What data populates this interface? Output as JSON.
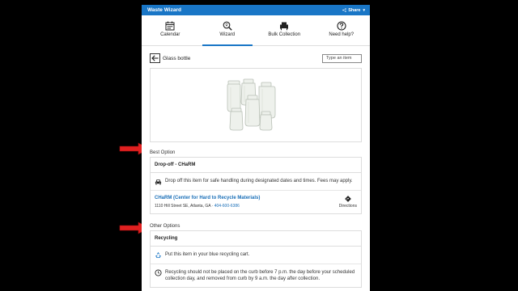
{
  "app": {
    "title": "Waste Wizard",
    "share_label": "Share"
  },
  "tabs": [
    {
      "label": "Calendar",
      "icon": "calendar-icon"
    },
    {
      "label": "Wizard",
      "icon": "wizard-search-icon"
    },
    {
      "label": "Bulk Collection",
      "icon": "armchair-icon"
    },
    {
      "label": "Need help?",
      "icon": "help-icon"
    }
  ],
  "active_tab": "Wizard",
  "item": {
    "title": "Glass bottle",
    "search_placeholder": "Type an item",
    "image_icon": "glass-jars-image"
  },
  "best_option": {
    "section_label": "Best Option",
    "card_title": "Drop-off - CHaRM",
    "instruction": "Drop off this item for safe handling during designated dates and times. Fees may apply.",
    "location": {
      "name": "CHaRM (Center for Hard to Recycle Materials)",
      "address": "1110 Hill Street SE, Atlanta, GA",
      "separator": " · ",
      "phone": "404-600-6386",
      "directions_label": "Directions"
    }
  },
  "other_options": {
    "section_label": "Other Options",
    "card_title": "Recycling",
    "rows": [
      {
        "icon": "recycle-icon",
        "text": "Put this item in your blue recycling cart."
      },
      {
        "icon": "clock-icon",
        "text": "Recycling should not be placed on the curb before 7 p.m. the day before your scheduled collection day, and removed from curb by 9 a.m. the day after collection."
      }
    ]
  },
  "colors": {
    "brand": "#1976c6",
    "link": "#1a6fb8",
    "annotation_arrow": "#e02020",
    "backdrop": "#000000"
  }
}
